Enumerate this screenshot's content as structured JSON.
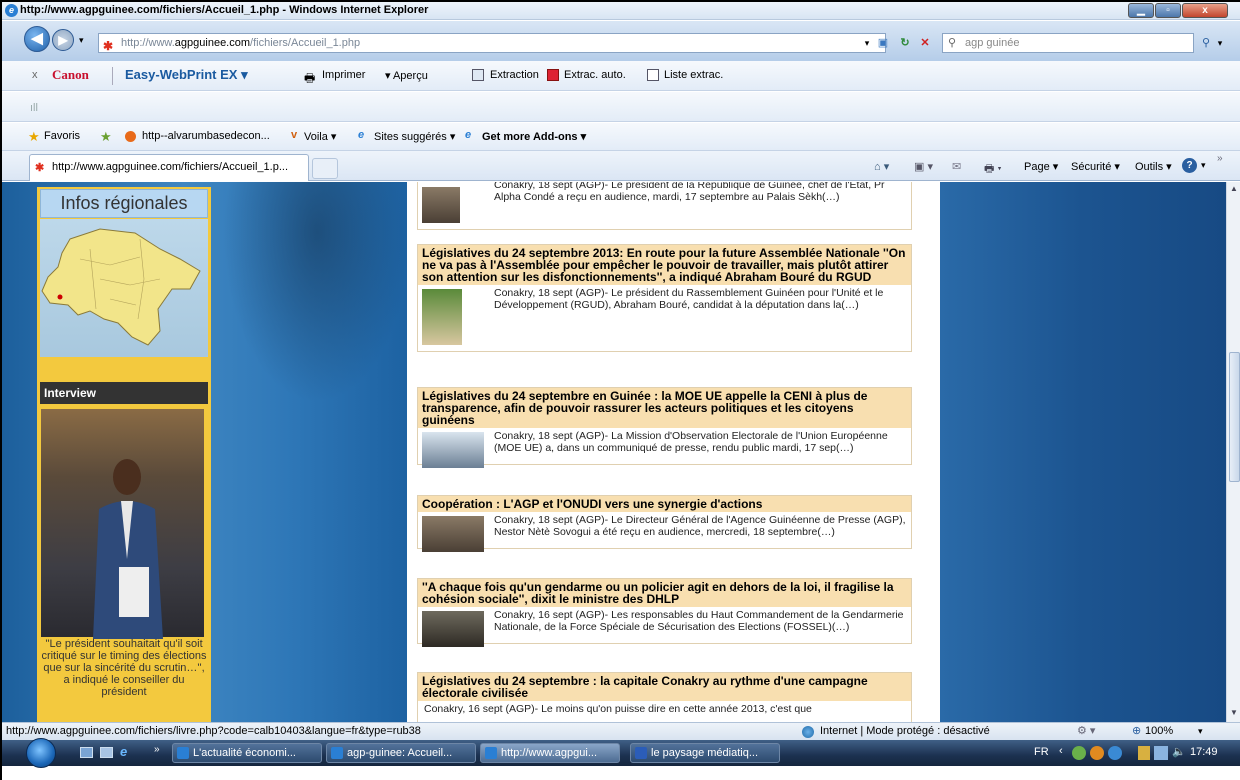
{
  "window": {
    "title": "http://www.agpguinee.com/fichiers/Accueil_1.php - Windows Internet Explorer"
  },
  "address": {
    "url_prefix": "http://www.",
    "url_domain": "agpguinee.com",
    "url_path": "/fichiers/Accueil_1.php",
    "search_value": "agp guinée"
  },
  "canon": {
    "close": "x",
    "brand": "Canon",
    "product": "Easy-WebPrint EX ▾",
    "print": "Imprimer",
    "preview": "▾ Aperçu",
    "extract": "Extraction",
    "auto_extract": "Extrac. auto.",
    "extract_list": "Liste extrac."
  },
  "favbar": {
    "favorites": "Favoris",
    "link1": "http--alvarumbasedecon...",
    "voila": "Voila ▾",
    "suggested": "Sites suggérés ▾",
    "addons": "Get more Add-ons ▾"
  },
  "tab": {
    "label": "http://www.agpguinee.com/fichiers/Accueil_1.p..."
  },
  "commands": {
    "page": "Page ▾",
    "security": "Sécurité ▾",
    "tools": "Outils ▾"
  },
  "sidebar": {
    "regional_title": "Infos régionales",
    "interview_title": "Interview",
    "quote": "''Le président souhaitait qu'il soit critiqué sur le timing des élections que sur la sincérité du scrutin…'', a indiqué le conseiller du président"
  },
  "articles": [
    {
      "headline": "",
      "body": "Conakry, 18 sept (AGP)- Le président de la République de Guinée, chef de l'Etat, Pr Alpha Condé a reçu en audience, mardi, 17 septembre au Palais Sèkh(…)"
    },
    {
      "headline": "Législatives du 24 septembre 2013: En route pour la future Assemblée Nationale ''On ne va pas à l'Assemblée pour empêcher le pouvoir de travailler, mais plutôt attirer son attention sur les disfonctionnements'', a indiqué Abraham Bouré du RGUD",
      "body": "Conakry, 18 sept (AGP)- Le président du Rassemblement Guinéen pour l'Unité et le Développement (RGUD), Abraham Bouré, candidat à la députation dans la(…)"
    },
    {
      "headline": "Législatives du 24 septembre en Guinée : la MOE UE appelle la CENI à plus de transparence, afin de pouvoir rassurer les acteurs politiques et les citoyens guinéens",
      "body": "Conakry, 18 sept (AGP)- La Mission d'Observation Electorale de l'Union Européenne (MOE UE) a, dans un communiqué de presse, rendu public mardi, 17 sep(…)"
    },
    {
      "headline": "Coopération : L'AGP et l'ONUDI vers une synergie d'actions",
      "body": "Conakry, 18 sept (AGP)- Le Directeur Général de l'Agence Guinéenne de Presse (AGP), Nestor Nètè Sovogui a été reçu en audience, mercredi, 18 septembre(…)"
    },
    {
      "headline": "''A chaque fois qu'un gendarme ou un policier agit en dehors de la loi, il fragilise la cohésion sociale'', dixit le ministre des DHLP",
      "body": "Conakry, 16 sept (AGP)- Les responsables du Haut Commandement de la Gendarmerie Nationale, de la Force Spéciale de Sécurisation des Elections (FOSSEL)(…)"
    },
    {
      "headline": "Législatives du 24 septembre : la capitale Conakry au rythme d'une campagne électorale civilisée",
      "body": "Conakry, 16 sept (AGP)- Le moins qu'on puisse dire en cette année 2013, c'est que"
    }
  ],
  "status": {
    "url": "http://www.agpguinee.com/fichiers/livre.php?code=calb10403&langue=fr&type=rub38",
    "zone": "Internet | Mode protégé : désactivé",
    "zoom": "100%"
  },
  "taskbar": {
    "items": [
      "L'actualité économi...",
      "agp-guinee: Accueil...",
      "http://www.agpgui...",
      "le paysage médiatiq..."
    ],
    "lang": "FR",
    "clock": "17:49"
  }
}
